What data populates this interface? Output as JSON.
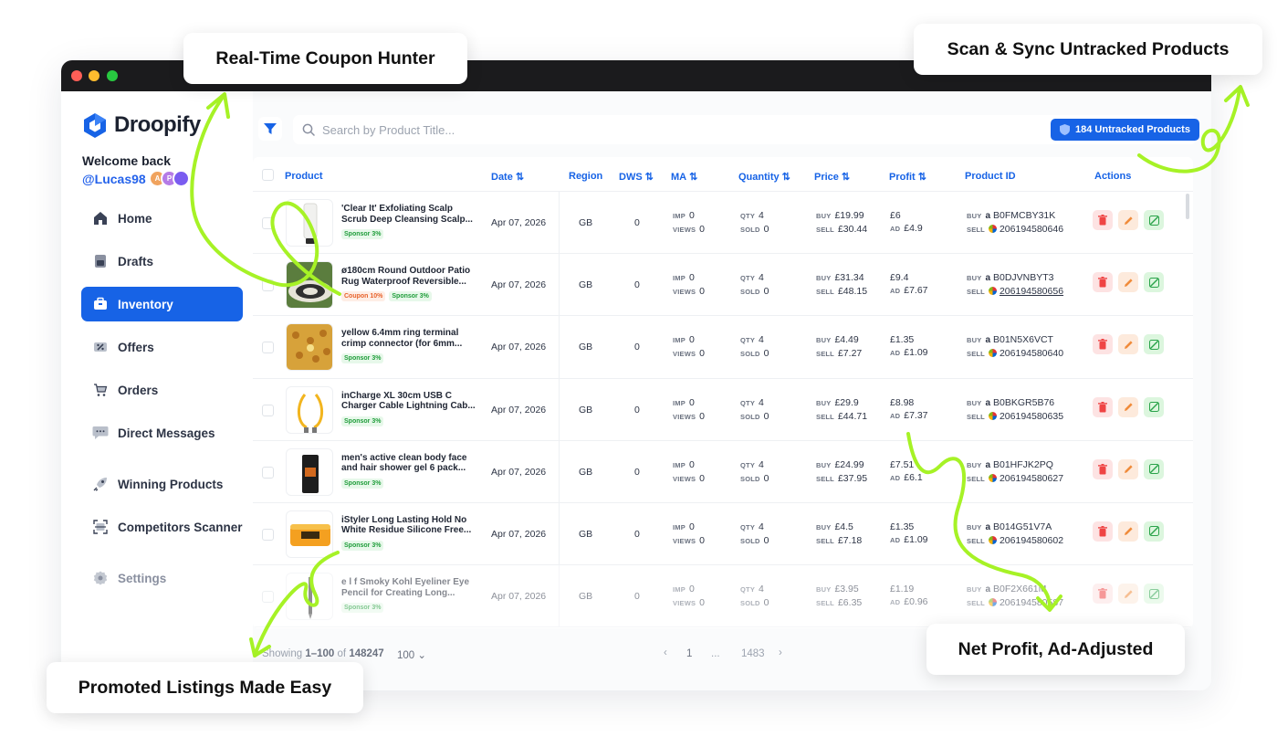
{
  "app": {
    "name": "Droopify",
    "welcome": "Welcome back",
    "username": "@Lucas98",
    "avatars": [
      {
        "initial": "A",
        "color": "#f0a35e"
      },
      {
        "initial": "P",
        "color": "#b57be6"
      },
      {
        "initial": "",
        "color": "#7a5cf0"
      }
    ]
  },
  "sidebar": {
    "items": [
      {
        "label": "Home",
        "icon": "home-icon",
        "active": false
      },
      {
        "label": "Drafts",
        "icon": "drafts-icon",
        "active": false
      },
      {
        "label": "Inventory",
        "icon": "inventory-icon",
        "active": true
      },
      {
        "label": "Offers",
        "icon": "offers-icon",
        "active": false
      },
      {
        "label": "Orders",
        "icon": "cart-icon",
        "active": false
      },
      {
        "label": "Direct Messages",
        "icon": "chat-icon",
        "active": false
      },
      {
        "label": "Winning Products",
        "icon": "rocket-icon",
        "active": false
      },
      {
        "label": "Competitors Scanner",
        "icon": "scanner-icon",
        "active": false
      },
      {
        "label": "Settings",
        "icon": "gear-icon",
        "active": false
      }
    ]
  },
  "toolbar": {
    "search_placeholder": "Search by Product Title...",
    "untracked_label": "184 Untracked Products"
  },
  "table": {
    "headers": {
      "product": "Product",
      "date": "Date",
      "region": "Region",
      "dws": "DWS",
      "ma": "MA",
      "quantity": "Quantity",
      "price": "Price",
      "profit": "Profit",
      "product_id": "Product ID",
      "actions": "Actions"
    },
    "labels": {
      "imp": "IMP",
      "views": "VIEWS",
      "qty": "QTY",
      "sold": "SOLD",
      "buy": "BUY",
      "sell": "SELL",
      "ad": "AD"
    },
    "rows": [
      {
        "title": "'Clear It' Exfoliating Scalp Scrub Deep Cleansing Scalp...",
        "coupon": "",
        "sponsor": "Sponsor 3%",
        "date": "Apr 07, 2026",
        "region": "GB",
        "dws": "0",
        "imp": "0",
        "views": "0",
        "qty": "4",
        "sold": "0",
        "buy_price": "£19.99",
        "sell_price": "£30.44",
        "profit": "£6",
        "ad": "£4.9",
        "asin": "B0FMCBY31K",
        "ebay_id": "206194580646",
        "thumb": "tube"
      },
      {
        "title": "ø180cm Round Outdoor Patio Rug Waterproof Reversible...",
        "coupon": "Coupon 10%",
        "sponsor": "Sponsor 3%",
        "date": "Apr 07, 2026",
        "region": "GB",
        "dws": "0",
        "imp": "0",
        "views": "0",
        "qty": "4",
        "sold": "0",
        "buy_price": "£31.34",
        "sell_price": "£48.15",
        "profit": "£9.4",
        "ad": "£7.67",
        "asin": "B0DJVNBYT3",
        "ebay_id": "206194580656",
        "thumb": "rug"
      },
      {
        "title": "yellow 6.4mm ring terminal crimp connector (for 6mm...",
        "coupon": "",
        "sponsor": "Sponsor 3%",
        "date": "Apr 07, 2026",
        "region": "GB",
        "dws": "0",
        "imp": "0",
        "views": "0",
        "qty": "4",
        "sold": "0",
        "buy_price": "£4.49",
        "sell_price": "£7.27",
        "profit": "£1.35",
        "ad": "£1.09",
        "asin": "B01N5X6VCT",
        "ebay_id": "206194580640",
        "thumb": "connectors"
      },
      {
        "title": "inCharge XL 30cm USB C Charger Cable Lightning Cab...",
        "coupon": "",
        "sponsor": "Sponsor 3%",
        "date": "Apr 07, 2026",
        "region": "GB",
        "dws": "0",
        "imp": "0",
        "views": "0",
        "qty": "4",
        "sold": "0",
        "buy_price": "£29.9",
        "sell_price": "£44.71",
        "profit": "£8.98",
        "ad": "£7.37",
        "asin": "B0BKGR5B76",
        "ebay_id": "206194580635",
        "thumb": "cable"
      },
      {
        "title": "men's active clean body face and hair shower gel 6 pack...",
        "coupon": "",
        "sponsor": "Sponsor 3%",
        "date": "Apr 07, 2026",
        "region": "GB",
        "dws": "0",
        "imp": "0",
        "views": "0",
        "qty": "4",
        "sold": "0",
        "buy_price": "£24.99",
        "sell_price": "£37.95",
        "profit": "£7.51",
        "ad": "£6.1",
        "asin": "B01HFJK2PQ",
        "ebay_id": "206194580627",
        "thumb": "gel"
      },
      {
        "title": "iStyler Long Lasting Hold No White Residue Silicone Free...",
        "coupon": "",
        "sponsor": "Sponsor 3%",
        "date": "Apr 07, 2026",
        "region": "GB",
        "dws": "0",
        "imp": "0",
        "views": "0",
        "qty": "4",
        "sold": "0",
        "buy_price": "£4.5",
        "sell_price": "£7.18",
        "profit": "£1.35",
        "ad": "£1.09",
        "asin": "B014G51V7A",
        "ebay_id": "206194580602",
        "thumb": "wax"
      },
      {
        "title": "e l f Smoky Kohl Eyeliner Eye Pencil for Creating Long...",
        "coupon": "",
        "sponsor": "Sponsor 3%",
        "date": "Apr 07, 2026",
        "region": "GB",
        "dws": "0",
        "imp": "0",
        "views": "0",
        "qty": "4",
        "sold": "0",
        "buy_price": "£3.95",
        "sell_price": "£6.35",
        "profit": "£1.19",
        "ad": "£0.96",
        "asin": "B0F2X661M",
        "ebay_id": "206194580587",
        "thumb": "pencil"
      }
    ]
  },
  "pagination": {
    "showing_prefix": "Showing",
    "range": "1–100",
    "of": "of",
    "total": "148247",
    "per_page": "100",
    "current": "1",
    "ellipsis": "...",
    "last": "1483"
  },
  "callouts": {
    "coupon": "Real-Time Coupon Hunter",
    "scan": "Scan & Sync Untracked Products",
    "profit": "Net Profit, Ad-Adjusted",
    "promoted": "Promoted Listings Made Easy"
  },
  "colors": {
    "accent": "#1763e6",
    "scribble": "#a6f226"
  }
}
